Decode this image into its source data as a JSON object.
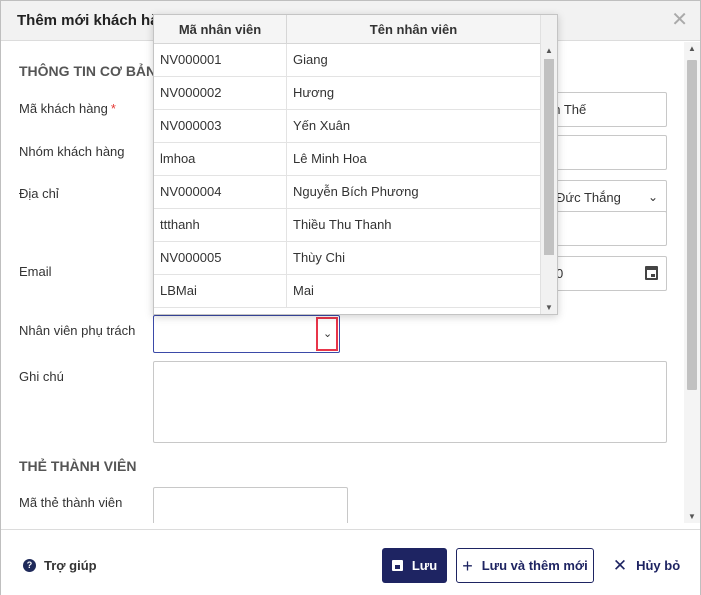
{
  "dialog": {
    "title": "Thêm mới khách hàng",
    "close_icon": "close-icon"
  },
  "sections": {
    "basic_info": "THÔNG TIN CƠ BẢN",
    "member_card": "THẺ THÀNH VIÊN"
  },
  "fields": {
    "customer_code": {
      "label": "Mã khách hàng",
      "required_mark": "*"
    },
    "customer_group": {
      "label": "Nhóm khách hàng"
    },
    "address": {
      "label": "Địa chỉ",
      "select_value_partial": "Đức Thắng"
    },
    "email": {
      "label": "Email",
      "date_value_partial": "0"
    },
    "staff": {
      "label": "Nhân viên phụ trách",
      "value": ""
    },
    "note": {
      "label": "Ghi chú"
    },
    "member_card_code": {
      "label": "Mã thẻ thành viên"
    },
    "customer_name_partial": "ần Thế"
  },
  "staff_dropdown": {
    "columns": [
      "Mã nhân viên",
      "Tên nhân viên"
    ],
    "rows": [
      {
        "code": "NV000001",
        "name": "Giang"
      },
      {
        "code": "NV000002",
        "name": "Hương"
      },
      {
        "code": "NV000003",
        "name": "Yến Xuân"
      },
      {
        "code": "lmhoa",
        "name": "Lê Minh Hoa"
      },
      {
        "code": "NV000004",
        "name": "Nguyễn Bích Phương"
      },
      {
        "code": "ttthanh",
        "name": "Thiều Thu Thanh"
      },
      {
        "code": "NV000005",
        "name": "Thùy Chi"
      },
      {
        "code": "LBMai",
        "name": "Mai"
      }
    ]
  },
  "footer": {
    "help_label": "Trợ giúp",
    "save_label": "Lưu",
    "save_new_label": "Lưu và thêm mới",
    "cancel_label": "Hủy bỏ"
  },
  "colors": {
    "primary": "#1e2462",
    "highlight_border": "#e8354a",
    "focus_border": "#3b4aa8",
    "required": "#e53935"
  }
}
